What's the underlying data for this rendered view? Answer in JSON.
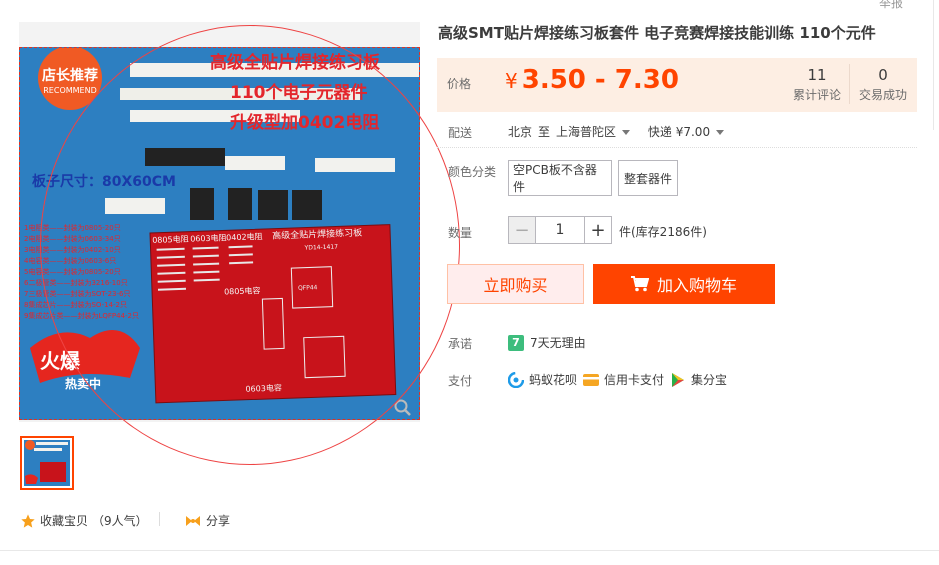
{
  "header": {
    "report_label": "举报"
  },
  "product": {
    "title": "高级SMT贴片焊接练习板套件 电子竞赛焊接技能训练 110个元件",
    "image_texts": {
      "badge": "店长推荐",
      "badge_sub": "RECOMMEND",
      "line1": "高级全贴片焊接练习板",
      "line2": "110个电子元器件",
      "line3": "升级型加0402电阻",
      "board_size": "板子尺寸：80X60CM",
      "hot": "火爆",
      "hot_sub": "热卖中",
      "pcb_title": "高级全贴片焊接练习板",
      "pcb_model": "YD14-1417",
      "pcb_col1": "0805电阻",
      "pcb_col2": "0603电阻",
      "pcb_col3": "0402电阻",
      "pcb_col4": "0805电容",
      "pcb_bottom": "0603电容",
      "pcb_chip": "QFP44",
      "parts_list": [
        "1电阻类——封装为0805-20只",
        "2电阻类——封装为0603-34只",
        "3电阻类——封装为0402-10只",
        "4电容类——封装为0603-6只",
        "5电容类——封装为0805-20只",
        "6二极管类——封装为3216-10只",
        "7三极管类——封装为SOT-23-6只",
        "8集成芯片——封装为SO-14-2只",
        "9集成芯片类——封装为LQFP44-2只"
      ]
    }
  },
  "gallery": {
    "favorite_label": "收藏宝贝",
    "favorite_count": "（9人气）",
    "share_label": "分享"
  },
  "price": {
    "label": "价格",
    "currency": "¥",
    "range": "3.50 - 7.30",
    "reviews_count": "11",
    "reviews_label": "累计评论",
    "deals_count": "0",
    "deals_label": "交易成功"
  },
  "shipping": {
    "label": "配送",
    "from": "北京",
    "to_word": "至",
    "destination": "上海普陀区",
    "method": "快递",
    "fee": "¥7.00"
  },
  "sku": {
    "label": "颜色分类",
    "options": [
      "空PCB板不含器件",
      "整套器件"
    ]
  },
  "quantity": {
    "label": "数量",
    "value": "1",
    "minus": "−",
    "plus": "+",
    "unit_stock": "件(库存2186件)"
  },
  "actions": {
    "buy_now": "立即购买",
    "add_to_cart": "加入购物车"
  },
  "promise": {
    "label": "承诺",
    "badge": "7",
    "text": "7天无理由"
  },
  "payment": {
    "label": "支付",
    "methods": [
      "蚂蚁花呗",
      "信用卡支付",
      "集分宝"
    ]
  },
  "colors": {
    "accent": "#ff4400",
    "price_bg": "#fdeee3",
    "promise_green": "#3dbd7d"
  }
}
